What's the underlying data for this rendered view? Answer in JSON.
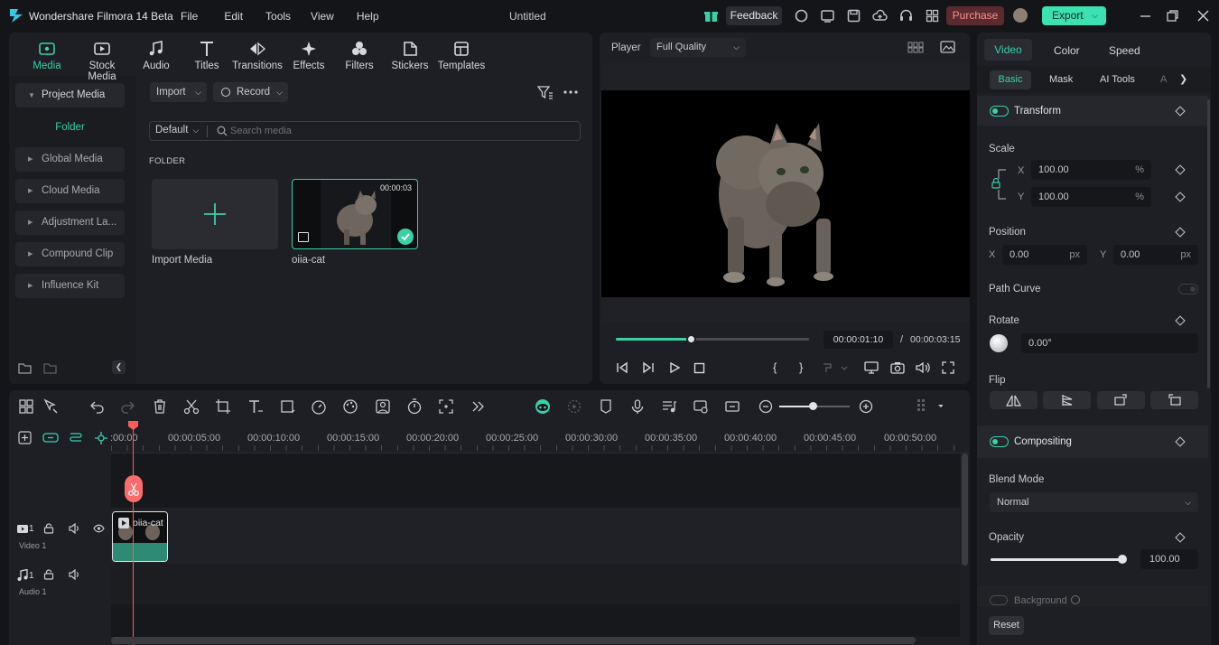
{
  "app": {
    "title": "Wondershare Filmora 14 Beta",
    "doc_title": "Untitled"
  },
  "menu": [
    "File",
    "Edit",
    "Tools",
    "View",
    "Help"
  ],
  "titlebar": {
    "feedback": "Feedback",
    "purchase": "Purchase",
    "export": "Export"
  },
  "media_tabs": [
    {
      "label": "Media",
      "icon": "media-icon"
    },
    {
      "label": "Stock Media",
      "icon": "stock-media-icon"
    },
    {
      "label": "Audio",
      "icon": "audio-icon"
    },
    {
      "label": "Titles",
      "icon": "titles-icon"
    },
    {
      "label": "Transitions",
      "icon": "transitions-icon"
    },
    {
      "label": "Effects",
      "icon": "effects-icon"
    },
    {
      "label": "Filters",
      "icon": "filters-icon"
    },
    {
      "label": "Stickers",
      "icon": "stickers-icon"
    },
    {
      "label": "Templates",
      "icon": "templates-icon"
    }
  ],
  "sidebar": {
    "project_media": "Project Media",
    "folder": "Folder",
    "items": [
      "Global Media",
      "Cloud Media",
      "Adjustment La...",
      "Compound Clip",
      "Influence Kit"
    ]
  },
  "media": {
    "import_label": "Import",
    "record_label": "Record",
    "sort_label": "Default",
    "search_placeholder": "Search media",
    "folder_header": "FOLDER",
    "import_media_label": "Import Media",
    "clip_name": "oiia-cat",
    "clip_duration": "00:00:03"
  },
  "player": {
    "label": "Player",
    "quality": "Full Quality",
    "current_time": "00:00:01:10",
    "separator": "/",
    "total_time": "00:00:03:15",
    "progress": 0.39
  },
  "props": {
    "tabs": [
      "Video",
      "Color",
      "Speed"
    ],
    "subtabs": [
      "Basic",
      "Mask",
      "AI Tools",
      "A"
    ],
    "transform": "Transform",
    "scale": "Scale",
    "scale_x_label": "X",
    "scale_y_label": "Y",
    "scale_x": "100.00",
    "scale_y": "100.00",
    "percent": "%",
    "position": "Position",
    "pos_x_label": "X",
    "pos_y_label": "Y",
    "pos_x": "0.00",
    "pos_y": "0.00",
    "px": "px",
    "path_curve": "Path Curve",
    "rotate": "Rotate",
    "rotate_value": "0.00°",
    "flip": "Flip",
    "compositing": "Compositing",
    "blend_mode": "Blend Mode",
    "blend_value": "Normal",
    "opacity": "Opacity",
    "opacity_value": "100.00",
    "opacity_level": 1.0,
    "background": "Background",
    "reset": "Reset"
  },
  "timeline": {
    "ruler": [
      ":00:00",
      "00:00:05:00",
      "00:00:10:00",
      "00:00:15:00",
      "00:00:20:00",
      "00:00:25:00",
      "00:00:30:00",
      "00:00:35:00",
      "00:00:40:00",
      "00:00:45:00",
      "00:00:50:00"
    ],
    "video_track_num": "1",
    "video_track_name": "Video 1",
    "audio_track_num": "1",
    "audio_track_name": "Audio 1",
    "clip_label": "oiia-cat"
  },
  "colors": {
    "accent": "#3ad0a6",
    "playhead": "#ff5a5a",
    "purchase_bg": "#5a2a2e",
    "export_bg": "#3de0b0"
  }
}
